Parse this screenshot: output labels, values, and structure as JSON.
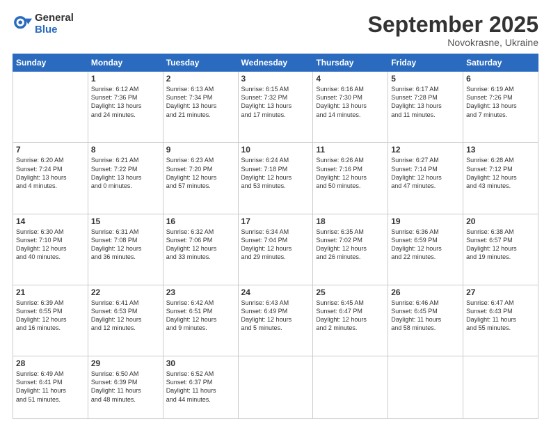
{
  "logo": {
    "general": "General",
    "blue": "Blue"
  },
  "header": {
    "month": "September 2025",
    "location": "Novokrasne, Ukraine"
  },
  "weekdays": [
    "Sunday",
    "Monday",
    "Tuesday",
    "Wednesday",
    "Thursday",
    "Friday",
    "Saturday"
  ],
  "weeks": [
    [
      {
        "day": "",
        "text": ""
      },
      {
        "day": "1",
        "text": "Sunrise: 6:12 AM\nSunset: 7:36 PM\nDaylight: 13 hours\nand 24 minutes."
      },
      {
        "day": "2",
        "text": "Sunrise: 6:13 AM\nSunset: 7:34 PM\nDaylight: 13 hours\nand 21 minutes."
      },
      {
        "day": "3",
        "text": "Sunrise: 6:15 AM\nSunset: 7:32 PM\nDaylight: 13 hours\nand 17 minutes."
      },
      {
        "day": "4",
        "text": "Sunrise: 6:16 AM\nSunset: 7:30 PM\nDaylight: 13 hours\nand 14 minutes."
      },
      {
        "day": "5",
        "text": "Sunrise: 6:17 AM\nSunset: 7:28 PM\nDaylight: 13 hours\nand 11 minutes."
      },
      {
        "day": "6",
        "text": "Sunrise: 6:19 AM\nSunset: 7:26 PM\nDaylight: 13 hours\nand 7 minutes."
      }
    ],
    [
      {
        "day": "7",
        "text": "Sunrise: 6:20 AM\nSunset: 7:24 PM\nDaylight: 13 hours\nand 4 minutes."
      },
      {
        "day": "8",
        "text": "Sunrise: 6:21 AM\nSunset: 7:22 PM\nDaylight: 13 hours\nand 0 minutes."
      },
      {
        "day": "9",
        "text": "Sunrise: 6:23 AM\nSunset: 7:20 PM\nDaylight: 12 hours\nand 57 minutes."
      },
      {
        "day": "10",
        "text": "Sunrise: 6:24 AM\nSunset: 7:18 PM\nDaylight: 12 hours\nand 53 minutes."
      },
      {
        "day": "11",
        "text": "Sunrise: 6:26 AM\nSunset: 7:16 PM\nDaylight: 12 hours\nand 50 minutes."
      },
      {
        "day": "12",
        "text": "Sunrise: 6:27 AM\nSunset: 7:14 PM\nDaylight: 12 hours\nand 47 minutes."
      },
      {
        "day": "13",
        "text": "Sunrise: 6:28 AM\nSunset: 7:12 PM\nDaylight: 12 hours\nand 43 minutes."
      }
    ],
    [
      {
        "day": "14",
        "text": "Sunrise: 6:30 AM\nSunset: 7:10 PM\nDaylight: 12 hours\nand 40 minutes."
      },
      {
        "day": "15",
        "text": "Sunrise: 6:31 AM\nSunset: 7:08 PM\nDaylight: 12 hours\nand 36 minutes."
      },
      {
        "day": "16",
        "text": "Sunrise: 6:32 AM\nSunset: 7:06 PM\nDaylight: 12 hours\nand 33 minutes."
      },
      {
        "day": "17",
        "text": "Sunrise: 6:34 AM\nSunset: 7:04 PM\nDaylight: 12 hours\nand 29 minutes."
      },
      {
        "day": "18",
        "text": "Sunrise: 6:35 AM\nSunset: 7:02 PM\nDaylight: 12 hours\nand 26 minutes."
      },
      {
        "day": "19",
        "text": "Sunrise: 6:36 AM\nSunset: 6:59 PM\nDaylight: 12 hours\nand 22 minutes."
      },
      {
        "day": "20",
        "text": "Sunrise: 6:38 AM\nSunset: 6:57 PM\nDaylight: 12 hours\nand 19 minutes."
      }
    ],
    [
      {
        "day": "21",
        "text": "Sunrise: 6:39 AM\nSunset: 6:55 PM\nDaylight: 12 hours\nand 16 minutes."
      },
      {
        "day": "22",
        "text": "Sunrise: 6:41 AM\nSunset: 6:53 PM\nDaylight: 12 hours\nand 12 minutes."
      },
      {
        "day": "23",
        "text": "Sunrise: 6:42 AM\nSunset: 6:51 PM\nDaylight: 12 hours\nand 9 minutes."
      },
      {
        "day": "24",
        "text": "Sunrise: 6:43 AM\nSunset: 6:49 PM\nDaylight: 12 hours\nand 5 minutes."
      },
      {
        "day": "25",
        "text": "Sunrise: 6:45 AM\nSunset: 6:47 PM\nDaylight: 12 hours\nand 2 minutes."
      },
      {
        "day": "26",
        "text": "Sunrise: 6:46 AM\nSunset: 6:45 PM\nDaylight: 11 hours\nand 58 minutes."
      },
      {
        "day": "27",
        "text": "Sunrise: 6:47 AM\nSunset: 6:43 PM\nDaylight: 11 hours\nand 55 minutes."
      }
    ],
    [
      {
        "day": "28",
        "text": "Sunrise: 6:49 AM\nSunset: 6:41 PM\nDaylight: 11 hours\nand 51 minutes."
      },
      {
        "day": "29",
        "text": "Sunrise: 6:50 AM\nSunset: 6:39 PM\nDaylight: 11 hours\nand 48 minutes."
      },
      {
        "day": "30",
        "text": "Sunrise: 6:52 AM\nSunset: 6:37 PM\nDaylight: 11 hours\nand 44 minutes."
      },
      {
        "day": "",
        "text": ""
      },
      {
        "day": "",
        "text": ""
      },
      {
        "day": "",
        "text": ""
      },
      {
        "day": "",
        "text": ""
      }
    ]
  ]
}
